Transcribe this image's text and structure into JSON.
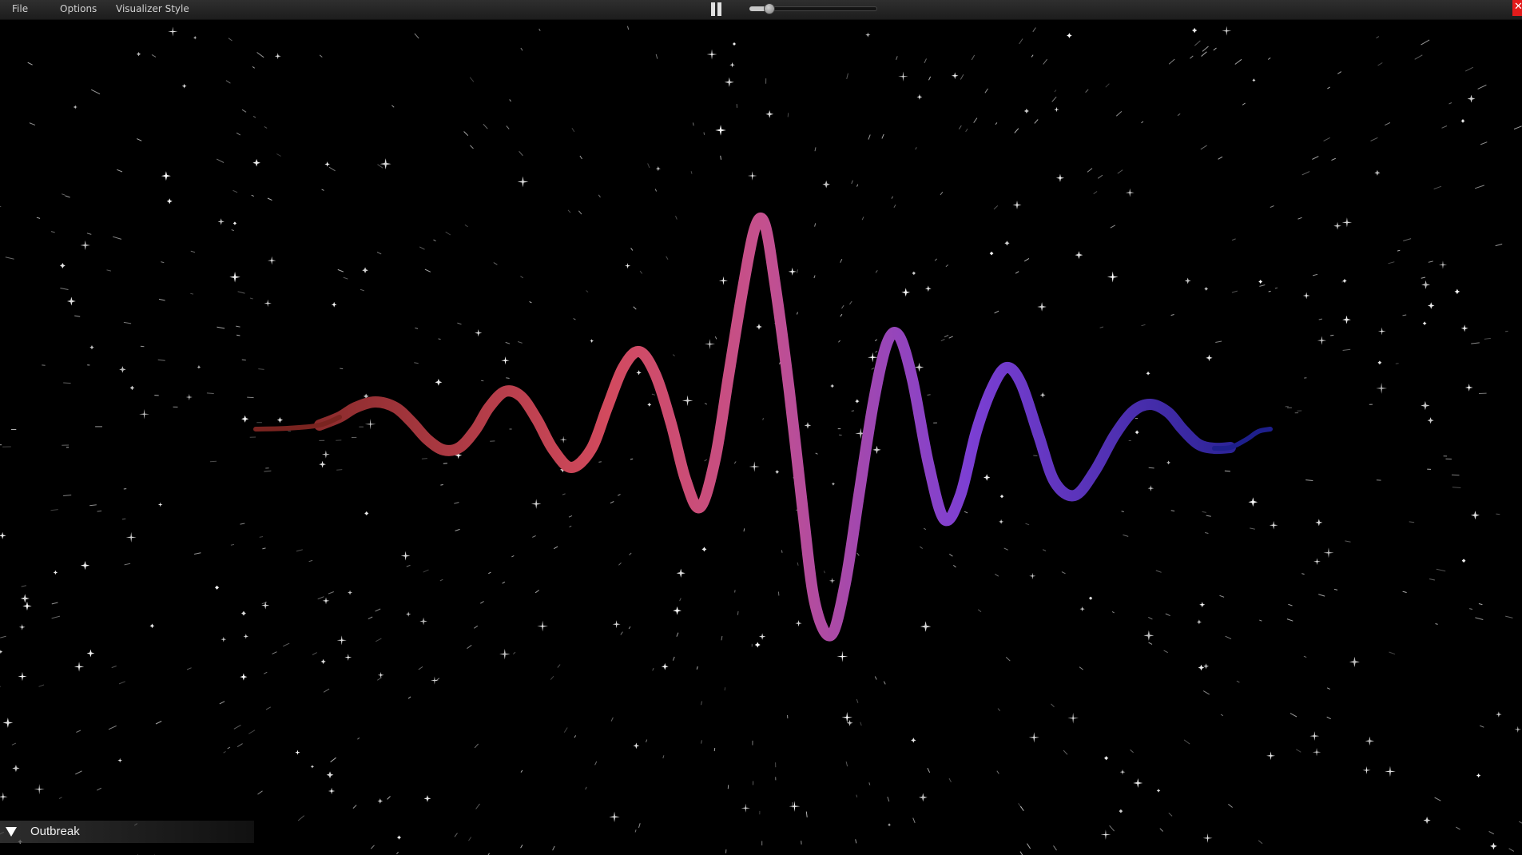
{
  "menu": {
    "file": "File",
    "options": "Options",
    "visualizer_style": "Visualizer Style"
  },
  "player": {
    "state": "playing",
    "volume": 0.12
  },
  "track": {
    "name": "Outbreak"
  },
  "icons": {
    "pause": "pause-icon",
    "close": "close-icon",
    "toggle": "triangle-down-icon"
  },
  "colors": {
    "wave_start": "#7a2420",
    "wave_red": "#d24a5e",
    "wave_pink": "#c4508e",
    "wave_purple": "#7c3fd4",
    "wave_end": "#1e1f8c",
    "close": "#e31b1b",
    "background": "#000000",
    "stars": "#ffffff"
  }
}
